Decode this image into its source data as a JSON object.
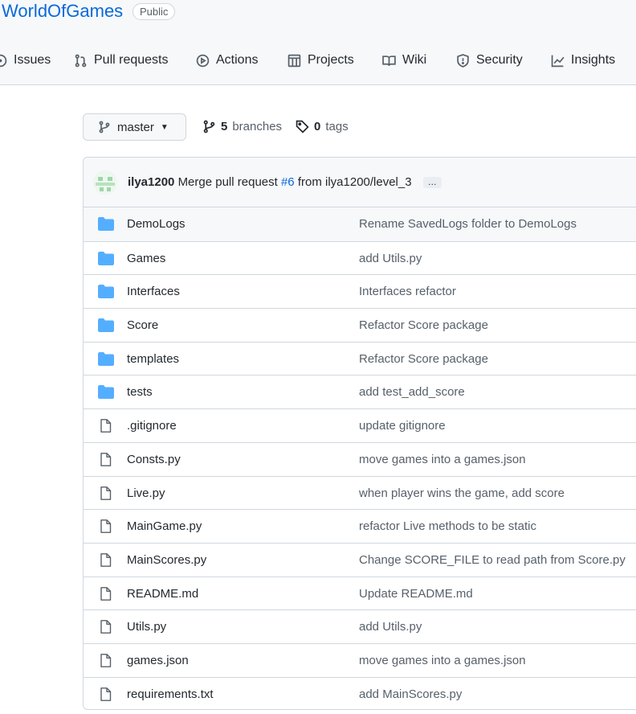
{
  "repo": {
    "name": "WorldOfGames",
    "visibility": "Public"
  },
  "tabs": [
    {
      "label": "Issues",
      "icon": "issues-icon"
    },
    {
      "label": "Pull requests",
      "icon": "pull-request-icon"
    },
    {
      "label": "Actions",
      "icon": "actions-icon"
    },
    {
      "label": "Projects",
      "icon": "projects-icon"
    },
    {
      "label": "Wiki",
      "icon": "wiki-icon"
    },
    {
      "label": "Security",
      "icon": "shield-icon"
    },
    {
      "label": "Insights",
      "icon": "insights-icon"
    }
  ],
  "branch": {
    "current": "master",
    "branches_count": "5",
    "branches_label": "branches",
    "tags_count": "0",
    "tags_label": "tags"
  },
  "commit": {
    "author": "ilya1200",
    "message_prefix": "Merge pull request",
    "pr": "#6",
    "message_suffix": "from ilya1200/level_3",
    "more": "…"
  },
  "files": [
    {
      "type": "folder",
      "name": "DemoLogs",
      "message": "Rename SavedLogs folder to DemoLogs"
    },
    {
      "type": "folder",
      "name": "Games",
      "message": "add Utils.py"
    },
    {
      "type": "folder",
      "name": "Interfaces",
      "message": "Interfaces refactor"
    },
    {
      "type": "folder",
      "name": "Score",
      "message": "Refactor Score package"
    },
    {
      "type": "folder",
      "name": "templates",
      "message": "Refactor Score package"
    },
    {
      "type": "folder",
      "name": "tests",
      "message": "add test_add_score"
    },
    {
      "type": "file",
      "name": ".gitignore",
      "message": "update gitignore"
    },
    {
      "type": "file",
      "name": "Consts.py",
      "message": "move games into a games.json"
    },
    {
      "type": "file",
      "name": "Live.py",
      "message": "when player wins the game, add score"
    },
    {
      "type": "file",
      "name": "MainGame.py",
      "message": "refactor Live methods to be static"
    },
    {
      "type": "file",
      "name": "MainScores.py",
      "message": "Change SCORE_FILE to read path from Score.py"
    },
    {
      "type": "file",
      "name": "README.md",
      "message": "Update README.md"
    },
    {
      "type": "file",
      "name": "Utils.py",
      "message": "add Utils.py"
    },
    {
      "type": "file",
      "name": "games.json",
      "message": "move games into a games.json"
    },
    {
      "type": "file",
      "name": "requirements.txt",
      "message": "add MainScores.py"
    }
  ],
  "colors": {
    "accent": "#0969da",
    "folder": "#54aeff",
    "border": "#d0d7de"
  }
}
